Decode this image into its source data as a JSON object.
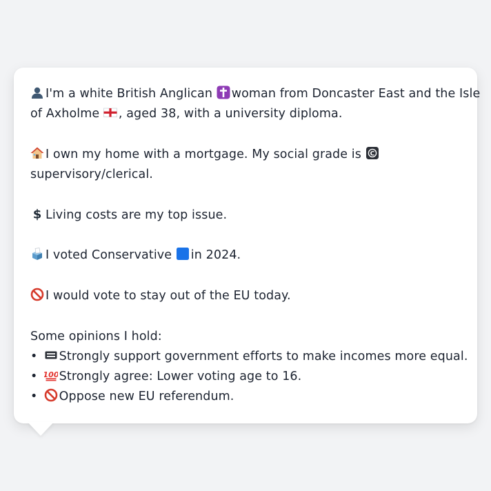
{
  "persona": {
    "identity": {
      "line1": "I'm a white British Anglican",
      "line1b": "woman from Doncaster East and the Isle",
      "line2a": "of Axholme",
      "line2b": ", aged 38, with a university diploma."
    },
    "housing": {
      "line1": "I own my home with a mortgage. My social grade is",
      "line2": "supervisory/clerical."
    },
    "issue": {
      "text": "Living costs are my top issue."
    },
    "vote": {
      "before": "I voted Conservative",
      "after": "in 2024."
    },
    "eu": {
      "text": "I would vote to stay out of the EU today."
    },
    "opinions": {
      "heading": "Some opinions I hold:",
      "items": [
        {
          "icon": "equals-icon",
          "text": "Strongly support government efforts to make incomes more equal."
        },
        {
          "icon": "hundred-points-icon",
          "text": "Strongly agree: Lower voting age to 16."
        },
        {
          "icon": "prohibited-icon",
          "text": "Oppose new EU referendum."
        }
      ]
    }
  },
  "icons": {
    "bust": "bust-in-silhouette-icon",
    "cross": "latin-cross-icon",
    "flag": "england-flag-icon",
    "house": "house-icon",
    "grade": "letter-c-icon",
    "dollar": "dollar-sign-icon",
    "ballot": "ballot-box-icon",
    "party": "blue-square-icon",
    "no": "prohibited-icon"
  },
  "colors": {
    "background": "#f2f3f5",
    "card": "#ffffff",
    "text": "#1c2330",
    "conservative_blue": "#1a73e8",
    "cross_purple": "#8e3bb5",
    "prohibited_red": "#d63a2b"
  }
}
